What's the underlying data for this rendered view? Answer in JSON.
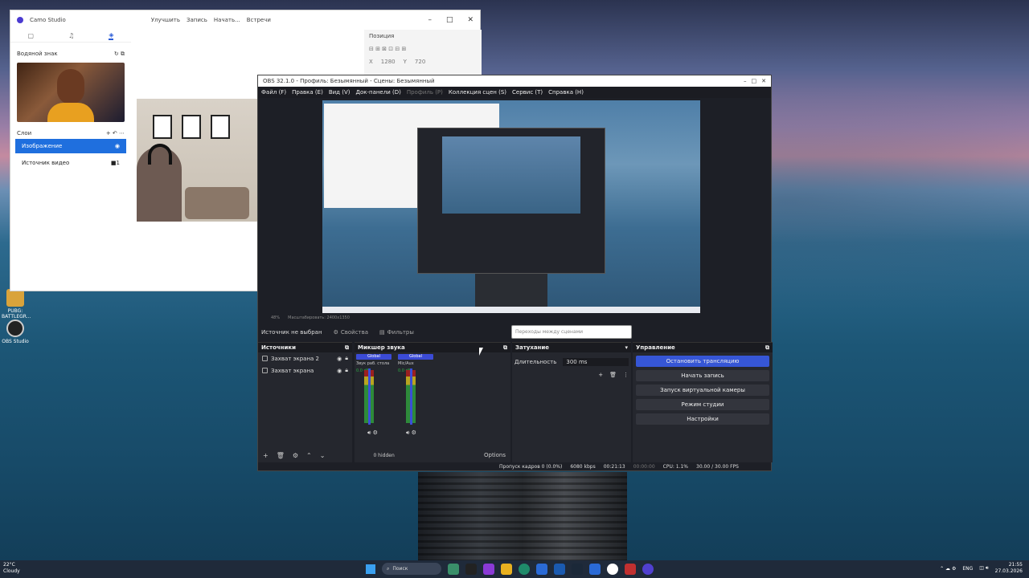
{
  "desktop": {
    "icons": [
      {
        "label": "PUBG: BATTLEGR..."
      },
      {
        "label": "OBS Studio"
      }
    ]
  },
  "camo": {
    "title": "Camo Studio",
    "toolbar": [
      "Улучшить",
      "Запись",
      "Начать...",
      "Встречи"
    ],
    "watermark_label": "Водяной знак",
    "layers_label": "Слои",
    "layers": [
      "Изображение",
      "Источник видео"
    ],
    "position_label": "Позиция",
    "x_label": "X",
    "x_value": "1280",
    "y_label": "Y",
    "y_value": "720"
  },
  "obs": {
    "title": "OBS 32.1.0 - Профиль: Безымянный - Сцены: Безымянный",
    "menu": [
      "Файл (F)",
      "Правка (E)",
      "Вид (V)",
      "Док-панели (D)",
      "Профиль (P)",
      "Коллекция сцен (S)",
      "Сервис (T)",
      "Справка (H)"
    ],
    "preview_status": [
      "48%",
      "Масштабировать: 2400x1350"
    ],
    "no_source": "Источник не выбран",
    "properties_btn": "Свойства",
    "filters_btn": "Фильтры",
    "transition_popup": "Переходы между сценами",
    "sources_title": "Источники",
    "sources": [
      "Захват экрана 2",
      "Захват экрана"
    ],
    "mixer_title": "Микшер звука",
    "mixer": [
      {
        "tag": "Global",
        "name": "Звук раб. стола",
        "db": "0.0 dB"
      },
      {
        "tag": "Global",
        "name": "Mic/Aux",
        "db": "0.0 dB"
      }
    ],
    "hidden_label": "0 hidden",
    "options_label": "Options",
    "transition_title": "Затухание",
    "duration_label": "Длительность",
    "duration_value": "300 ms",
    "controls_title": "Управление",
    "controls": [
      "Остановить трансляцию",
      "Начать запись",
      "Запуск виртуальной камеры",
      "Режим студии",
      "Настройки"
    ],
    "status": {
      "dropped": "Пропуск кадров 0 (0.0%)",
      "bitrate": "6080 kbps",
      "stream_time": "00:21:13",
      "rec_time": "00:00:00",
      "cpu": "CPU: 1.1%",
      "fps": "30.00 / 30.00 FPS"
    }
  },
  "taskbar": {
    "weather_temp": "22°C",
    "weather_desc": "Cloudy",
    "search": "Поиск",
    "lang": "ENG",
    "time": "21:55",
    "date": "27.03.2026"
  }
}
